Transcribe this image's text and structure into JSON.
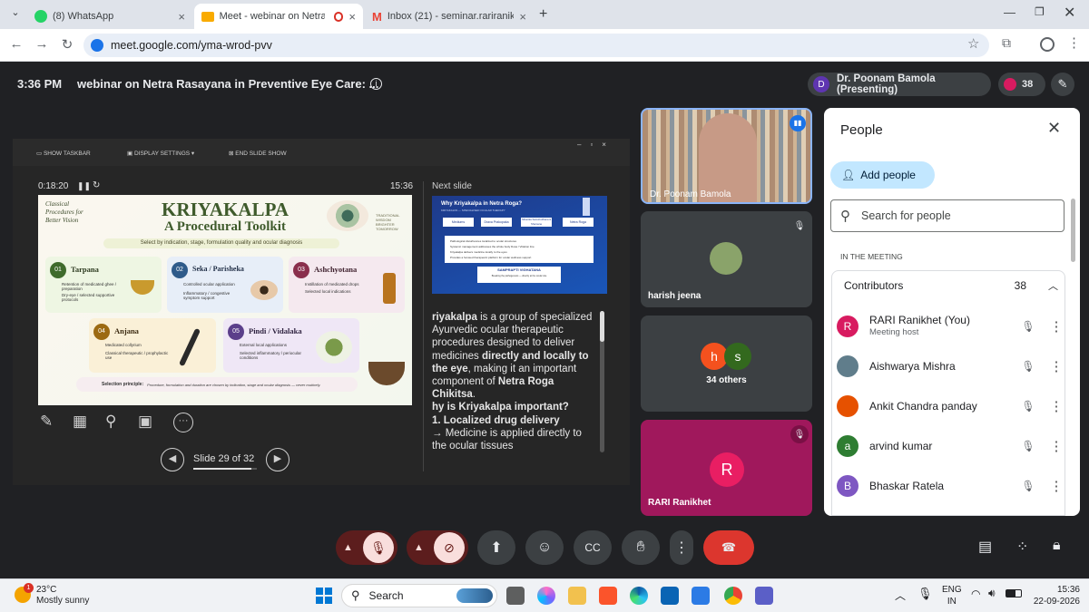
{
  "browser": {
    "tabs": [
      {
        "title": "(8) WhatsApp"
      },
      {
        "title": "Meet - webinar on Netra Ra"
      },
      {
        "title": "Inbox (21) - seminar.rariranikhet"
      }
    ],
    "url": "meet.google.com/yma-wrod-pvv"
  },
  "meet": {
    "time": "3:36 PM",
    "meeting_title": "webinar on Netra Rasayana in Preventive Eye Care: ...",
    "presenter": "Dr. Poonam Bamola (Presenting)",
    "presenter_initial": "D",
    "participant_count": "38",
    "tiles": {
      "speaker_name": "Dr. Poonam Bamola",
      "harish_name": "harish jeena",
      "others_label": "34 others",
      "others_initials": [
        "h",
        "s"
      ],
      "rari_name": "RARI Ranikhet",
      "rari_initial": "R"
    }
  },
  "slideshow": {
    "toolbar": [
      "SHOW TASKBAR",
      "DISPLAY SETTINGS ▾",
      "END SLIDE SHOW"
    ],
    "elapsed": "0:18:20",
    "clock": "15:36",
    "next_label": "Next slide",
    "slide_counter": "Slide 29 of 32",
    "slide": {
      "side_note": "Classical Procedures for Better Vision",
      "title1": "KRIYAKALPA",
      "title2": "A Procedural Toolkit",
      "right_note": "TRADITIONAL WISDOM BRIGHTER TOMORROW",
      "subtitle": "Select by indication, stage, formulation quality and ocular diagnosis",
      "cards": [
        {
          "num": "01",
          "name": "Tarpana",
          "points": [
            "Retention of medicated ghee / preparation",
            "Dry-eye / selected supportive protocols"
          ]
        },
        {
          "num": "02",
          "name": "Seka / Parisheka",
          "points": [
            "Controlled ocular application",
            "Inflammatory / congestive symptom support"
          ]
        },
        {
          "num": "03",
          "name": "Ashchyotana",
          "points": [
            "Instillation of medicated drops",
            "Selected local indications"
          ]
        },
        {
          "num": "04",
          "name": "Anjana",
          "points": [
            "Medicated collyrium",
            "Classical therapeutic / prophylactic use"
          ]
        },
        {
          "num": "05",
          "name": "Pindi / Vidalaka",
          "points": [
            "External local applications",
            "Selected inflammatory / periocular conditions"
          ]
        }
      ],
      "principle_label": "Selection principle:",
      "principle_text": "Procedure, formulation and duration are chosen by indication, stage and ocular diagnosis — never routinely."
    },
    "next_slide": {
      "title": "Why Kriyakalpa in Netra Roga?",
      "subtitle": "KRIYAKALPA — SPECIALISED OCULAR THERAPY",
      "boxes": [
        "Mediums",
        "Drava Prakopaka",
        "Sthanika Samshodhana & Shamana",
        "Netra Roga"
      ],
      "bullets": [
        "Pathological disturbances localized to ocular structures",
        "Systemic management addresses the whole body Dosa / Vitiation line",
        "Kriyakalpa delivers medicine locally to the eyes",
        "Provides a focused therapeutic platform for ocular wellness support"
      ],
      "footer_title": "SAMPRAPTI VIGHATANA",
      "footer_text": "Breaking the pathogenesis — directly at the ocular site"
    },
    "notes": [
      {
        "t": "riyakalpa",
        "b": true
      },
      {
        "t": " is a group of specialized Ayurvedic ocular therapeutic procedures designed to deliver medicines ",
        "b": false
      },
      {
        "t": "directly and locally to the eye",
        "b": true
      },
      {
        "t": ", making it an important component of ",
        "b": false
      },
      {
        "t": "Netra Roga Chikitsa",
        "b": true
      },
      {
        "t": ".",
        "b": false
      }
    ],
    "notes_heading1": "hy is Kriyakalpa important?",
    "notes_heading2": "1. Localized drug delivery",
    "notes_tail": "→ Medicine is applied directly to the ocular tissues"
  },
  "people_panel": {
    "title": "People",
    "add_label": "Add people",
    "search_placeholder": "Search for people",
    "section": "IN THE MEETING",
    "group": "Contributors",
    "group_count": "38",
    "participants": [
      {
        "name": "RARI Ranikhet (You)",
        "sub": "Meeting host",
        "initial": "R",
        "color": "#d81b60"
      },
      {
        "name": "Aishwarya Mishra",
        "sub": "",
        "initial": "",
        "color": "#607d8b"
      },
      {
        "name": "Ankit Chandra panday",
        "sub": "",
        "initial": "",
        "color": "#e65100"
      },
      {
        "name": "arvind kumar",
        "sub": "",
        "initial": "a",
        "color": "#2e7d32"
      },
      {
        "name": "Bhaskar Ratela",
        "sub": "",
        "initial": "B",
        "color": "#7e57c2"
      }
    ]
  },
  "taskbar": {
    "temp": "23°C",
    "weather": "Mostly sunny",
    "weather_badge": "1",
    "search": "Search",
    "lang1": "ENG",
    "lang2": "IN",
    "time": "15:36",
    "date": "22-09-2026"
  }
}
